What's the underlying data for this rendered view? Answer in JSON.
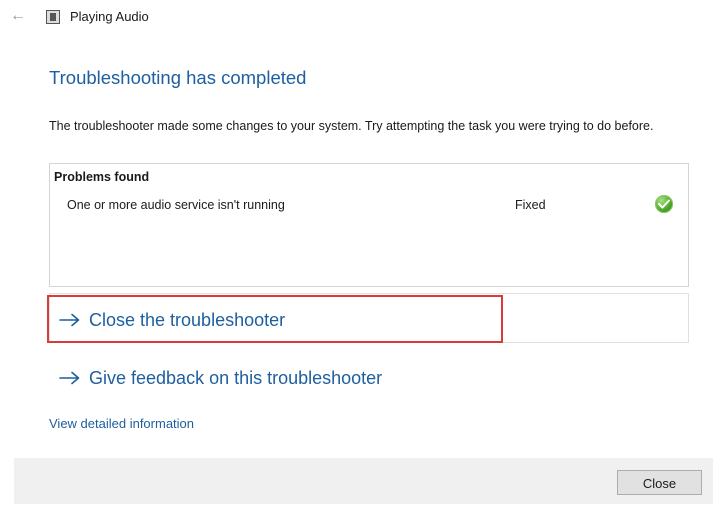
{
  "window": {
    "title": "Playing Audio",
    "back_icon": "back-arrow-icon",
    "app_icon": "audio-app-icon"
  },
  "main": {
    "heading": "Troubleshooting has completed",
    "description": "The troubleshooter made some changes to your system. Try attempting the task you were trying to do before.",
    "problems": {
      "header": "Problems found",
      "items": [
        {
          "name": "One or more audio service isn't running",
          "status": "Fixed",
          "icon": "green-check-icon"
        }
      ]
    },
    "links": {
      "close_troubleshooter": "Close the troubleshooter",
      "give_feedback": "Give feedback on this troubleshooter",
      "view_details": "View detailed information"
    }
  },
  "footer": {
    "close_label": "Close"
  },
  "colors": {
    "link": "#1e5fa0",
    "highlight_border": "#d93b3b",
    "footer_bg": "#f0f0f0",
    "status_ok": "#4fa82a"
  }
}
